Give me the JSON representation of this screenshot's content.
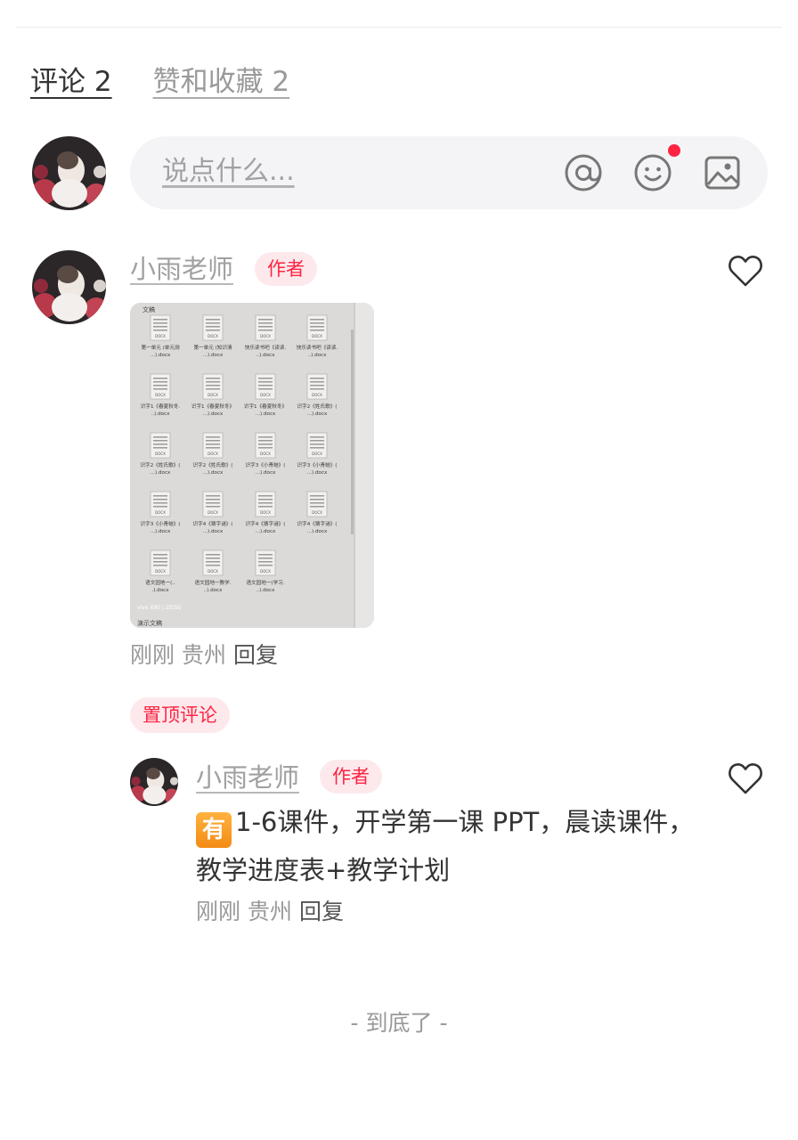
{
  "tabs": [
    {
      "label": "评论 2",
      "active": true
    },
    {
      "label": "赞和收藏 2",
      "active": false
    }
  ],
  "comment_input": {
    "placeholder": "说点什么...",
    "icons": [
      "at-icon",
      "emoji-icon",
      "image-icon"
    ],
    "emoji_has_notification": true
  },
  "comment": {
    "username": "小雨老师",
    "author_badge": "作者",
    "time": "刚刚",
    "location": "贵州",
    "reply_label": "回复",
    "image": {
      "header": "文稿",
      "footer_label": "演示文稿",
      "watermark": "vivo X90 | ZEISS",
      "files": [
        "第一单元 (单元测...).docx",
        "第一单元 (知识清...).docx",
        "快乐读书吧《读读...).docx",
        "快乐读书吧《读读...).docx",
        "识字1《春夏秋冬...).docx",
        "识字1《春夏秋冬》...).docx",
        "识字1《春夏秋冬》...).docx",
        "识字2《姓氏歌》(...).docx",
        "识字2《姓氏歌》(...).docx",
        "识字2《姓氏歌》(...).docx",
        "识字3《小青蛙》(...).docx",
        "识字3《小青蛙》(...).docx",
        "识字3《小青蛙》(...).docx",
        "识字4《猜字谜》(...).docx",
        "识字4《猜字谜》(...).docx",
        "识字4《猜字谜》(...).docx",
        "语文园地一(...).docx",
        "语文园地一教学...).docx",
        "语文园地一(学习...).docx"
      ]
    }
  },
  "pinned_label": "置顶评论",
  "reply": {
    "username": "小雨老师",
    "author_badge": "作者",
    "badge_char": "有",
    "text": "1-6课件，开学第一课 PPT，晨读课件，教学进度表+教学计划",
    "time": "刚刚",
    "location": "贵州",
    "reply_label": "回复"
  },
  "end_text": "- 到底了 -",
  "colors": {
    "accent": "#ff2442",
    "badge_bg": "#fde9ec",
    "input_bg": "#f4f4f6"
  }
}
